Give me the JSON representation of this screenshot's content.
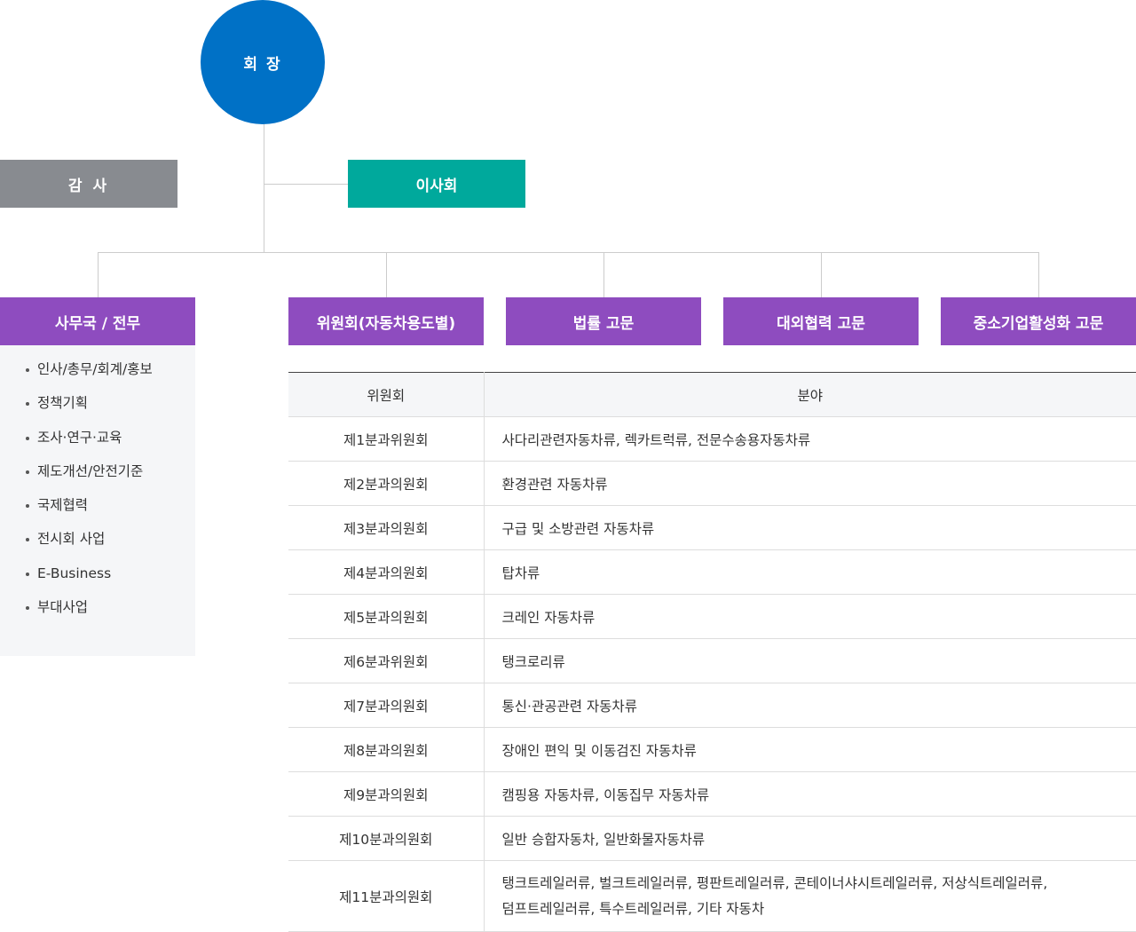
{
  "chairman": "회 장",
  "auditor": "감 사",
  "board": "이사회",
  "departments": [
    "사무국 / 전무",
    "위원회(자동차용도별)",
    "법률 고문",
    "대외협력 고문",
    "중소기업활성화 고문"
  ],
  "secretariat_duties": [
    "인사/총무/회계/홍보",
    "정책기획",
    "조사·연구·교육",
    "제도개선/안전기준",
    "국제협력",
    "전시회 사업",
    "E-Business",
    "부대사업"
  ],
  "committee_table": {
    "headers": [
      "위원회",
      "분야"
    ],
    "rows": [
      [
        "제1분과위원회",
        "사다리관련자동차류, 렉카트럭류, 전문수송용자동차류"
      ],
      [
        "제2분과의원회",
        "환경관련 자동차류"
      ],
      [
        "제3분과의원회",
        "구급 및 소방관련 자동차류"
      ],
      [
        "제4분과의원회",
        "탑차류"
      ],
      [
        "제5분과의원회",
        "크레인 자동차류"
      ],
      [
        "제6분과위원회",
        "탱크로리류"
      ],
      [
        "제7분과의원회",
        "통신·관공관련 자동차류"
      ],
      [
        "제8분과의원회",
        "장애인 편익 및 이동검진 자동차류"
      ],
      [
        "제9분과의원회",
        "캠핑용 자동차류, 이동집무 자동차류"
      ],
      [
        "제10분과의원회",
        "일반 승합자동차, 일반화물자동차류"
      ],
      [
        "제11분과의원회",
        "탱크트레일러류, 벌크트레일러류, 평판트레일러류, 콘테이너샤시트레일러류, 저상식트레일러류,",
        "덤프트레일러류, 특수트레일러류, 기타 자동차"
      ]
    ]
  }
}
